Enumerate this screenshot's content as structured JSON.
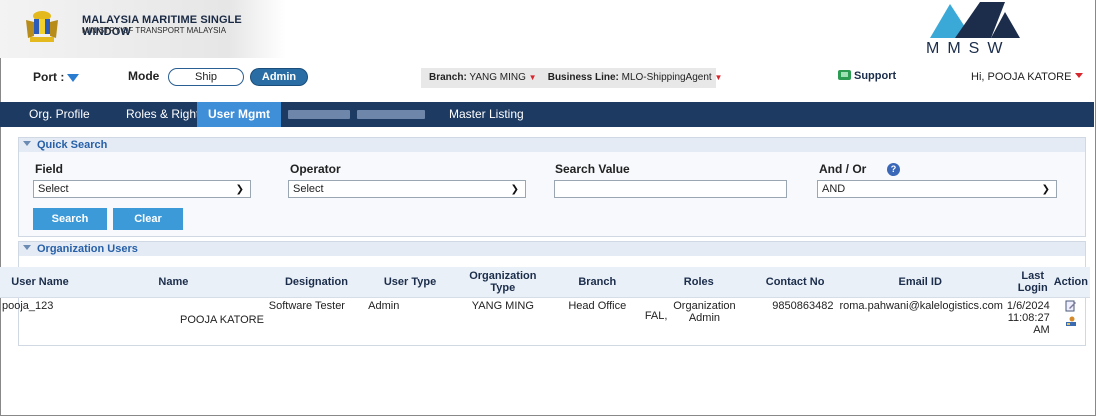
{
  "header": {
    "brand_title": "MALAYSIA MARITIME SINGLE WINDOW",
    "brand_subtitle": "MINISTRY OF TRANSPORT MALAYSIA",
    "logo_text": "MMSW",
    "crest_icon": "malaysia-coat-of-arms-icon",
    "logo_icon": "mmsw-logo-icon"
  },
  "controls": {
    "port_label": "Port :",
    "mode_label": "Mode",
    "mode_options": [
      "Ship",
      "Admin"
    ],
    "mode_selected": "Admin",
    "branch_label": "Branch:",
    "branch_value": "YANG MING",
    "business_line_label": "Business Line:",
    "business_line_value": "MLO-ShippingAgent",
    "support_label": "Support",
    "user_greeting": "Hi, POOJA KATORE"
  },
  "nav": {
    "items": [
      {
        "label": "Org. Profile",
        "active": false
      },
      {
        "label": "Roles & Rights",
        "active": false
      },
      {
        "label": "User Mgmt",
        "active": true
      },
      {
        "label": "Master Listing",
        "active": false
      }
    ]
  },
  "quick_search": {
    "title": "Quick Search",
    "field_label": "Field",
    "field_value": "Select",
    "operator_label": "Operator",
    "operator_value": "Select",
    "search_value_label": "Search Value",
    "search_value": "",
    "andor_label": "And / Or",
    "andor_value": "AND",
    "help_icon": "?",
    "search_button": "Search",
    "clear_button": "Clear"
  },
  "org_users": {
    "title": "Organization Users",
    "columns": [
      "User Name",
      "Name",
      "Designation",
      "User Type",
      "Organization Type",
      "Branch",
      "Roles",
      "Contact No",
      "Email ID",
      "Last Login",
      "Action"
    ],
    "rows": [
      {
        "user_name": "pooja_123",
        "name": "POOJA KATORE",
        "designation": "Software Tester",
        "user_type": "Admin",
        "organization_type": "YANG MING",
        "branch": "Head Office",
        "roles_prefix": "FAL,",
        "roles": "Organization Admin",
        "contact_no": "9850863482",
        "email": "roma.pahwani@kalelogistics.com",
        "last_login": "1/6/2024 11:08:27 AM",
        "actions": [
          "edit-icon",
          "user-map-icon"
        ]
      }
    ]
  },
  "colors": {
    "navbar": "#1d3a63",
    "nav_active": "#3e8ed8",
    "button": "#3d9ad8",
    "panel_head": "#e4ebf4",
    "accent_red": "#d9262c"
  }
}
